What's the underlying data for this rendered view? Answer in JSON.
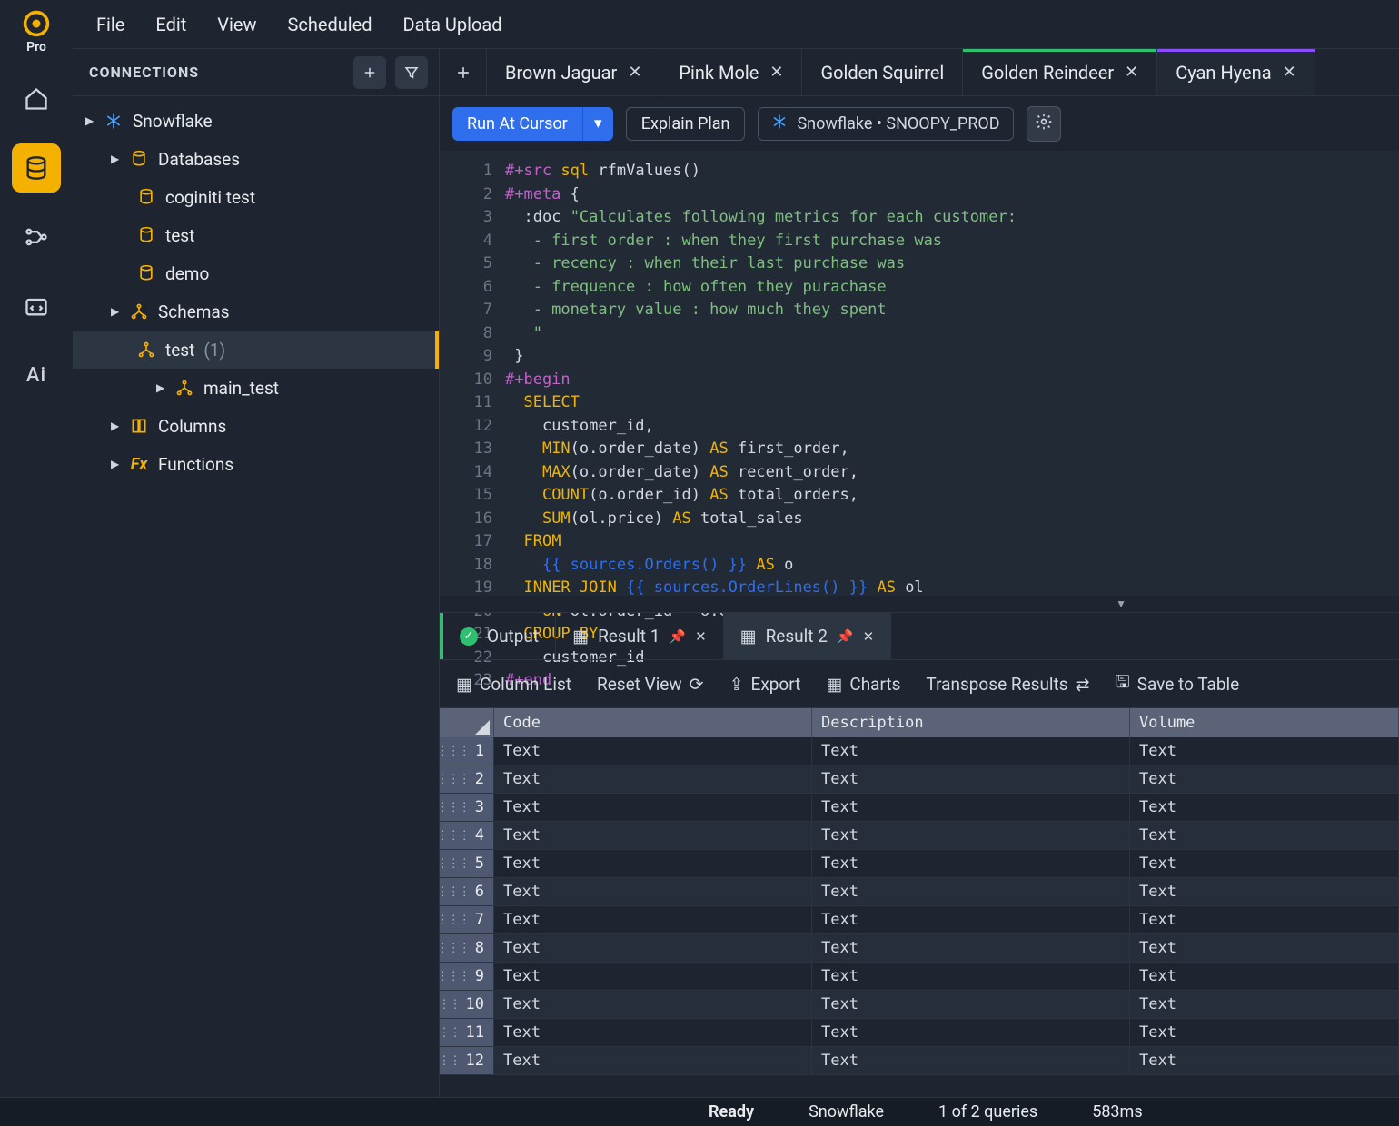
{
  "brand": {
    "pro_label": "Pro"
  },
  "menu": {
    "file": "File",
    "edit": "Edit",
    "view": "View",
    "scheduled": "Scheduled",
    "data_upload": "Data Upload"
  },
  "connections": {
    "title": "CONNECTIONS",
    "root": "Snowflake",
    "databases_group": "Databases",
    "databases": [
      "coginiti test",
      "test",
      "demo"
    ],
    "schemas_group": "Schemas",
    "schema_selected": {
      "name": "test",
      "count": "(1)"
    },
    "schema_other": "main_test",
    "columns_group": "Columns",
    "functions_group": "Functions"
  },
  "tabs": [
    {
      "label": "Brown Jaguar",
      "closable": true
    },
    {
      "label": "Pink Mole",
      "closable": true
    },
    {
      "label": "Golden Squirrel",
      "closable": false
    },
    {
      "label": "Golden Reindeer",
      "closable": true,
      "accent": "green"
    },
    {
      "label": "Cyan Hyena",
      "closable": true,
      "accent": "purple",
      "active": true
    }
  ],
  "toolbar": {
    "run": "Run At Cursor",
    "explain": "Explain Plan",
    "context": "Snowflake • SNOOPY_PROD"
  },
  "code_lines": 23,
  "results": {
    "tabs": {
      "output": "Output",
      "r1": "Result 1",
      "r2": "Result 2"
    },
    "tools": {
      "column_list": "Column List",
      "reset_view": "Reset View",
      "export": "Export",
      "charts": "Charts",
      "transpose": "Transpose Results",
      "save": "Save to Table"
    },
    "columns": [
      "Code",
      "Description",
      "Volume"
    ],
    "row_value": "Text",
    "row_count": 12
  },
  "status": {
    "ready": "Ready",
    "conn": "Snowflake",
    "queries": "1 of 2 queries",
    "time": "583ms"
  }
}
